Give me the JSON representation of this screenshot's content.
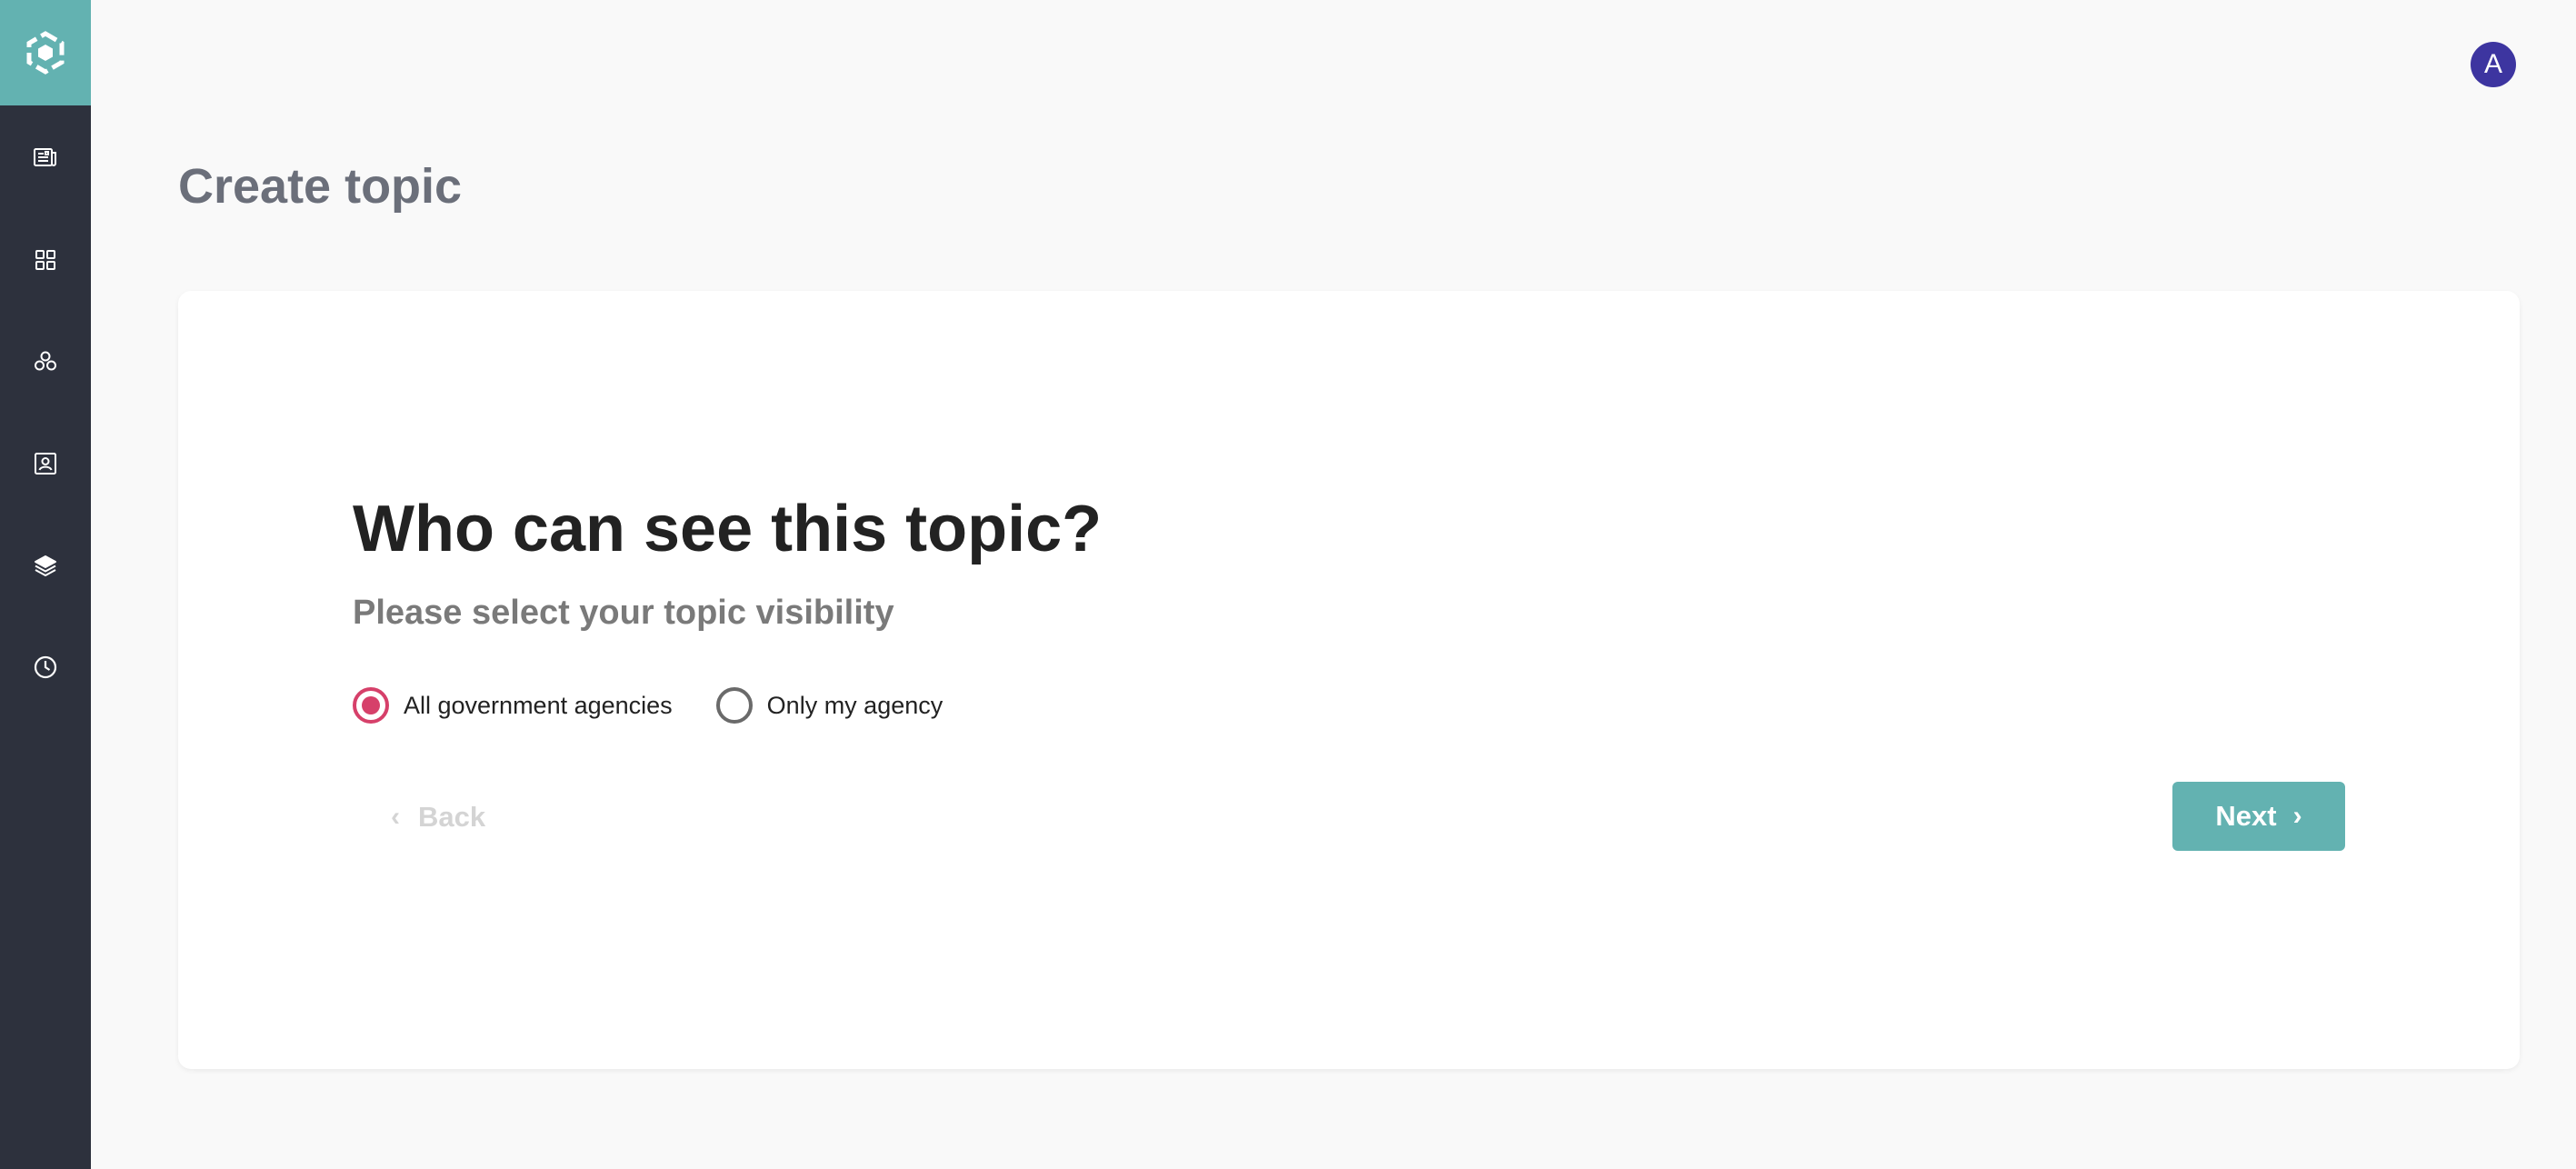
{
  "user": {
    "avatar_initial": "A"
  },
  "page": {
    "title": "Create topic"
  },
  "sidebar": {
    "logo_icon": "cube-logo-icon",
    "items": [
      {
        "icon": "news-icon"
      },
      {
        "icon": "grid-icon"
      },
      {
        "icon": "community-icon"
      },
      {
        "icon": "contact-card-icon"
      },
      {
        "icon": "layers-icon"
      },
      {
        "icon": "clock-icon"
      }
    ]
  },
  "form": {
    "question": "Who can see this topic?",
    "subtitle": "Please select your topic visibility",
    "options": [
      {
        "label": "All government agencies",
        "selected": true
      },
      {
        "label": "Only my agency",
        "selected": false
      }
    ],
    "back_label": "Back",
    "next_label": "Next"
  },
  "colors": {
    "sidebar_bg": "#2d313d",
    "accent_teal": "#63b2b1",
    "radio_selected": "#d6406a",
    "avatar_bg": "#3d35a0"
  }
}
